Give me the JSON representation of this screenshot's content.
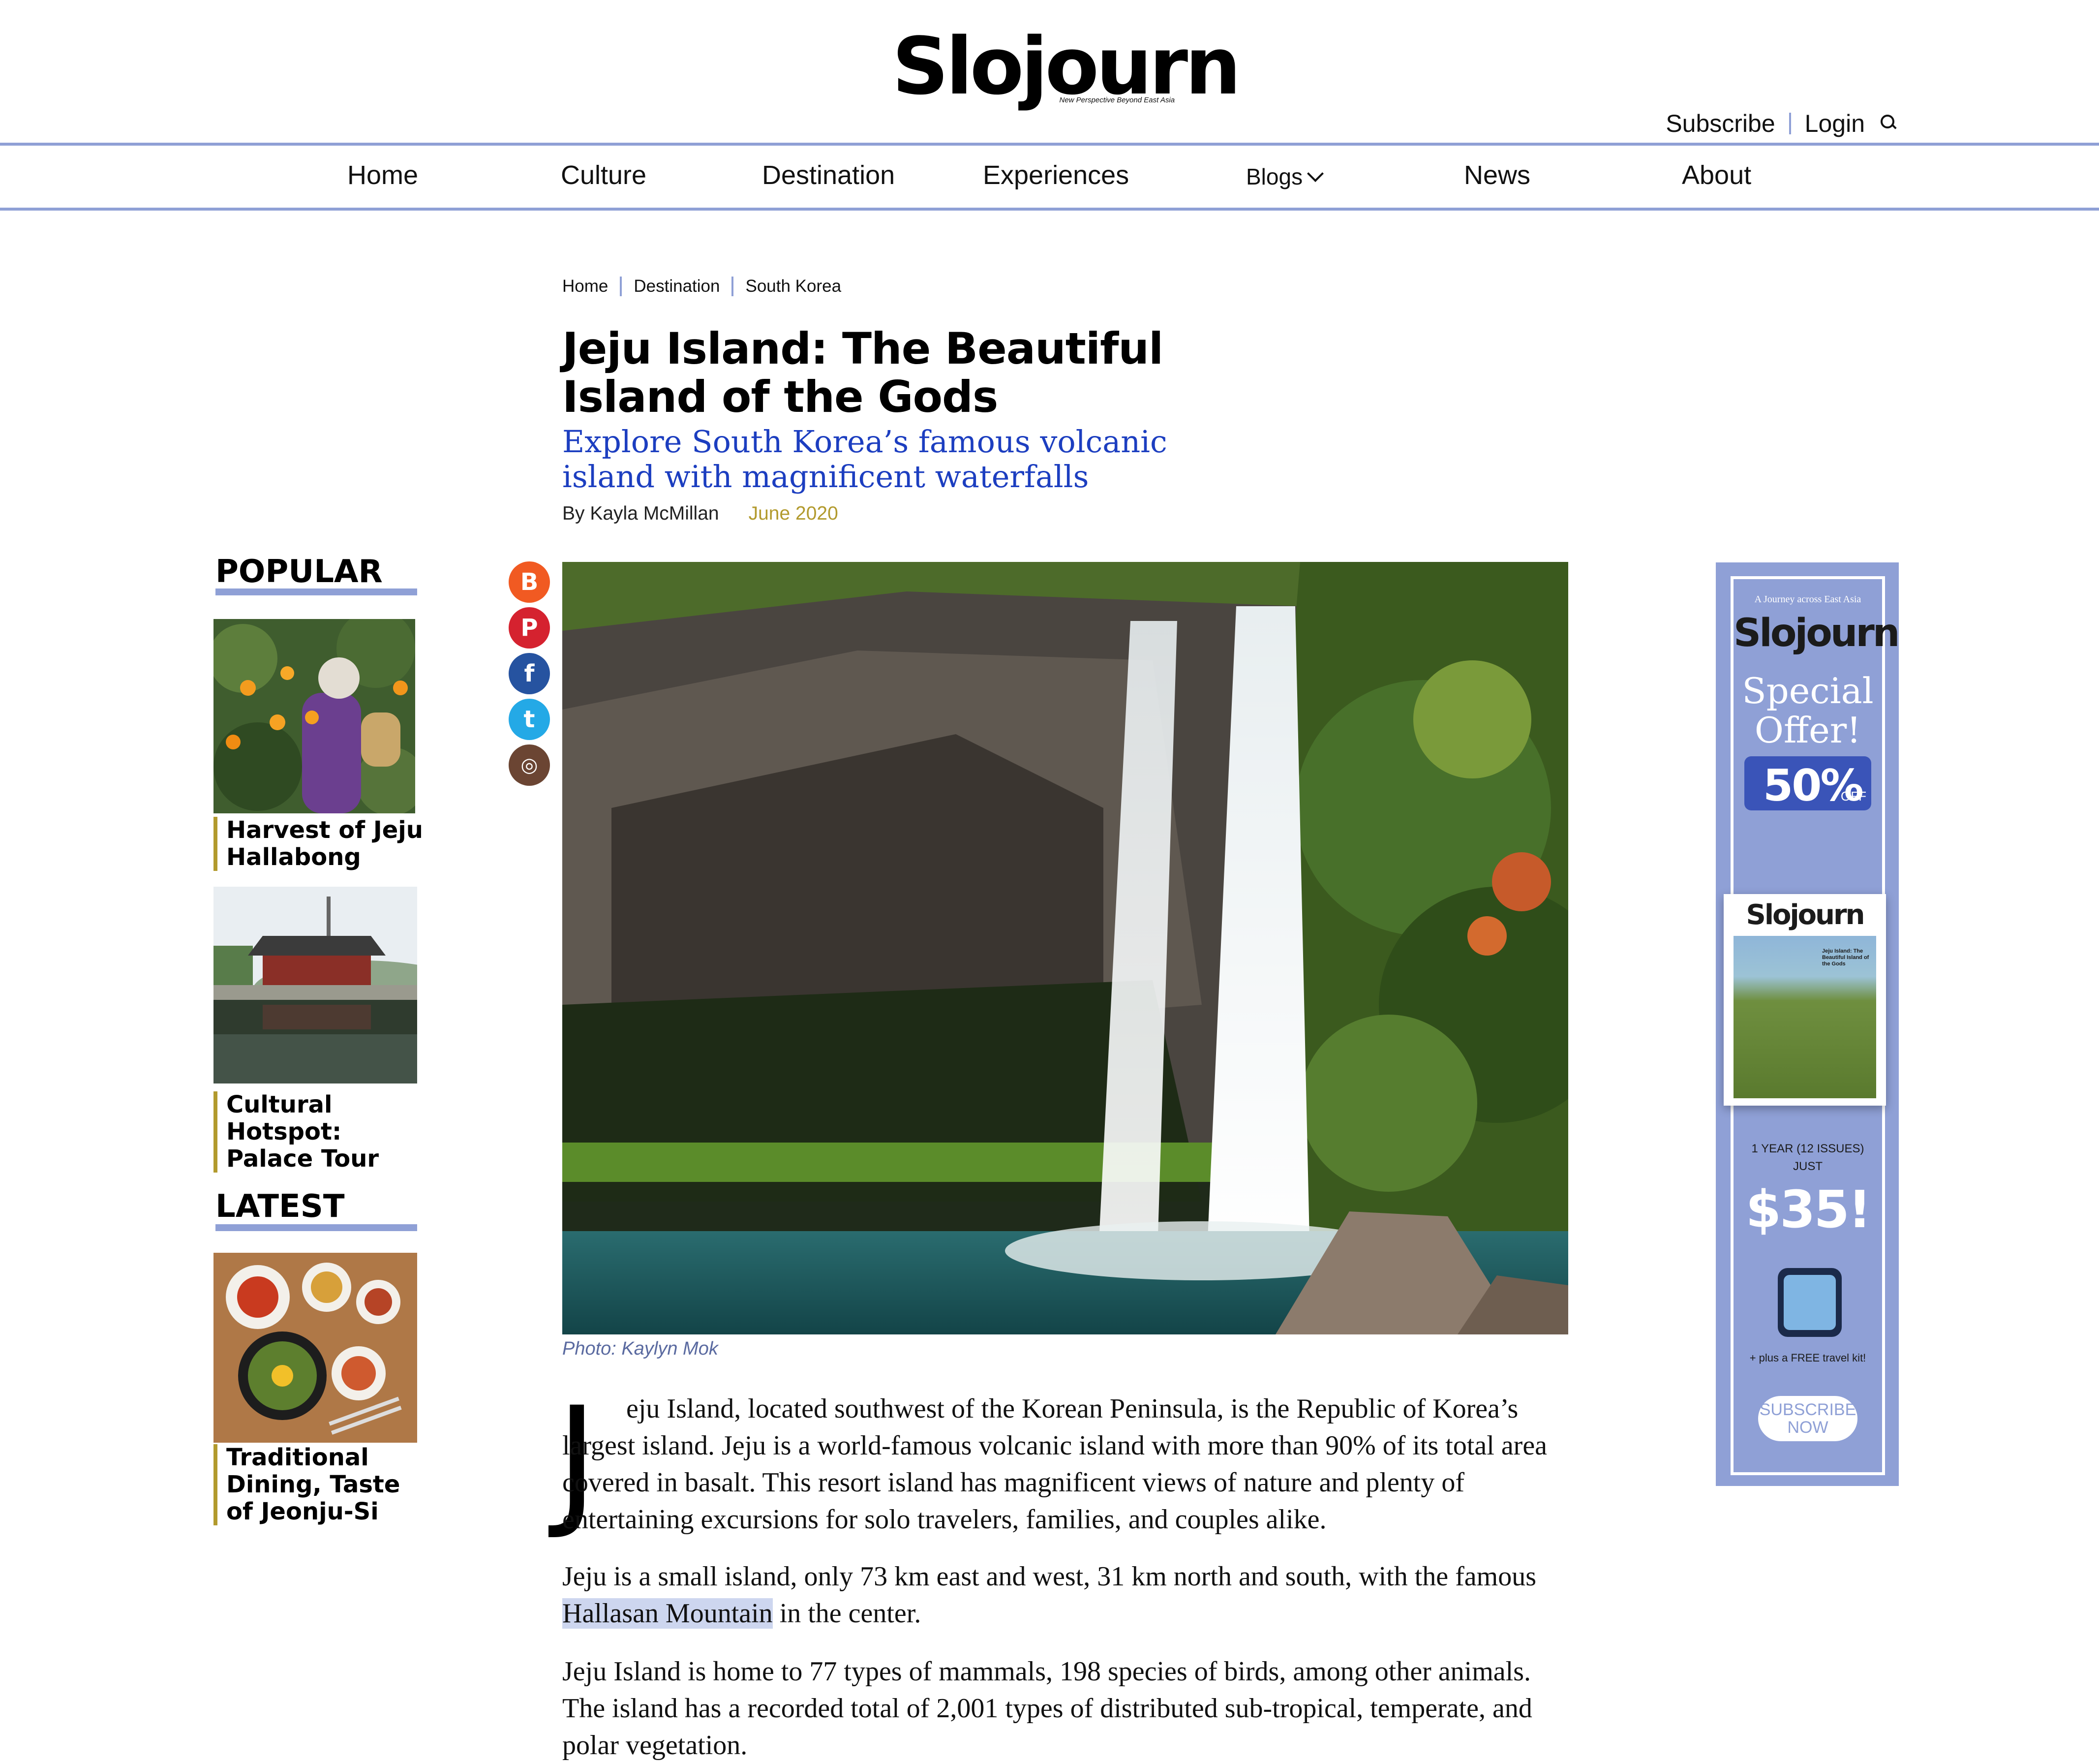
{
  "site": {
    "logo": "Slojourn",
    "tagline": "New Perspective Beyond East Asia"
  },
  "top_links": {
    "subscribe": "Subscribe",
    "login": "Login"
  },
  "nav": {
    "home": "Home",
    "culture": "Culture",
    "destination": "Destination",
    "experiences": "Experiences",
    "blogs": "Blogs",
    "news": "News",
    "about": "About"
  },
  "breadcrumb": {
    "home": "Home",
    "destination": "Destination",
    "country": "South Korea"
  },
  "article": {
    "title": "Jeju Island: The Beautiful Island of the Gods",
    "subtitle": "Explore South Korea’s famous volcanic island with magnificent waterfalls",
    "author": "By Kayla McMillan",
    "date": "June 2020",
    "photo_credit": "Photo: Kaylyn Mok",
    "dropcap": "J",
    "p1": "eju Island, located southwest of the Korean Peninsula, is the Republic of Korea’s largest island. Jeju is a world-famous volcanic island with more than 90% of its total area covered in basalt. This resort island has magnificent views of nature and plenty of entertaining excursions for solo travelers, families, and couples alike.",
    "p2_before": "Jeju is a small island, only 73 km east and west, 31 km north and south, with the famous ",
    "p2_link": "Hallasan Mountain",
    "p2_after": " in the center.",
    "p3": "Jeju Island is home to 77 types of mammals, 198 species of birds, among other animals. The island has a recorded total of 2,001 types of distributed sub-tropical, temperate, and polar vegetation."
  },
  "sidebar": {
    "popular_heading": "POPULAR",
    "latest_heading": "LATEST",
    "popular": [
      {
        "label": "Harvest of Jeju Hallabong"
      },
      {
        "label": "Cultural Hotspot: Palace Tour"
      }
    ],
    "latest": [
      {
        "label": "Traditional Dining, Taste of Jeonju-Si"
      }
    ]
  },
  "social": [
    "blogger-icon",
    "pinterest-icon",
    "facebook-icon",
    "twitter-icon",
    "instagram-icon"
  ],
  "ad": {
    "kicker": "A Journey across East Asia",
    "logo": "Slojourn",
    "headline1": "Special",
    "headline2": "Offer!",
    "discount": "50%",
    "discount_suffix": "OFF",
    "cover_logo": "Slojourn",
    "cover_title": "Jeju Island: The Beautiful Island of the Gods",
    "term1": "1 YEAR (12 ISSUES)",
    "term2": "JUST",
    "price": "$35!",
    "extra": "+ plus a FREE travel kit!",
    "cta": "SUBSCRIBE NOW"
  },
  "colors": {
    "accent": "#8fa0d6",
    "link_blue": "#1c3ec0",
    "gold": "#b29a2d"
  }
}
